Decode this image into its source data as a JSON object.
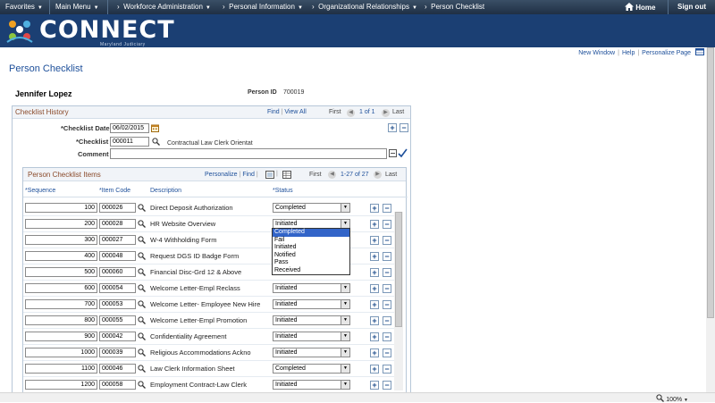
{
  "topnav": {
    "favorites": "Favorites",
    "main_menu": "Main Menu",
    "crumbs": [
      "Workforce Administration",
      "Personal Information",
      "Organizational Relationships",
      "Person Checklist"
    ],
    "home": "Home",
    "signout": "Sign out"
  },
  "banner": {
    "logo_text": "CONNECT",
    "logo_sub": "Maryland Judiciary"
  },
  "toplinks": [
    "New Window",
    "Help",
    "Personalize Page"
  ],
  "page_title": "Person Checklist",
  "employee": {
    "name": "Jennifer Lopez",
    "person_id_label": "Person ID",
    "person_id": "700019"
  },
  "history": {
    "title": "Checklist History",
    "find": "Find",
    "view_all": "View All",
    "first": "First",
    "range": "1 of 1",
    "last": "Last",
    "date_label": "*Checklist Date",
    "date_value": "06/02/2015",
    "checklist_label": "*Checklist",
    "checklist_value": "000011",
    "checklist_desc": "Contractual Law Clerk Orientat",
    "comment_label": "Comment",
    "comment_value": ""
  },
  "items": {
    "title": "Person Checklist Items",
    "personalize": "Personalize",
    "find": "Find",
    "first": "First",
    "range": "1-27 of 27",
    "last": "Last",
    "headers": {
      "sequence": "*Sequence",
      "item_code": "*Item Code",
      "description": "Description",
      "status": "*Status"
    },
    "rows": [
      {
        "seq": "100",
        "code": "000026",
        "desc": "Direct Deposit Authorization",
        "status": "Completed"
      },
      {
        "seq": "200",
        "code": "000028",
        "desc": "HR Website Overview",
        "status": "Initiated"
      },
      {
        "seq": "300",
        "code": "000027",
        "desc": "W-4 Withholding Form",
        "status": ""
      },
      {
        "seq": "400",
        "code": "000048",
        "desc": "Request DGS ID Badge Form",
        "status": ""
      },
      {
        "seq": "500",
        "code": "000060",
        "desc": "Financial Disc-Grd 12 & Above",
        "status": ""
      },
      {
        "seq": "600",
        "code": "000054",
        "desc": "Welcome Letter-Empl Reclass",
        "status": "Initiated"
      },
      {
        "seq": "700",
        "code": "000053",
        "desc": "Welcome Letter- Employee New Hire",
        "status": "Initiated"
      },
      {
        "seq": "800",
        "code": "000055",
        "desc": "Welcome Letter-Empl Promotion",
        "status": "Initiated"
      },
      {
        "seq": "900",
        "code": "000042",
        "desc": "Confidentiality Agreement",
        "status": "Initiated"
      },
      {
        "seq": "1000",
        "code": "000039",
        "desc": "Religious Accommodations Ackno",
        "status": "Initiated"
      },
      {
        "seq": "1100",
        "code": "000046",
        "desc": "Law Clerk Information Sheet",
        "status": "Completed"
      },
      {
        "seq": "1200",
        "code": "000058",
        "desc": "Employment Contract-Law Clerk",
        "status": "Initiated"
      }
    ],
    "dropdown_options": [
      "Completed",
      "Fail",
      "Initiated",
      "Notified",
      "Pass",
      "Received"
    ]
  },
  "statusbar": {
    "zoom": "100%"
  },
  "colors": {
    "nav_bg": "#2a3d55",
    "banner_bg": "#1b3f73",
    "link": "#1d4f9a",
    "section_title": "#8a4a2a",
    "highlight": "#3264c8"
  },
  "icons": [
    "home-icon",
    "lookup-icon",
    "calendar-icon",
    "add-row-icon",
    "delete-row-icon",
    "spellcheck-icon",
    "personalize-grid-icon",
    "zoom-icon"
  ]
}
